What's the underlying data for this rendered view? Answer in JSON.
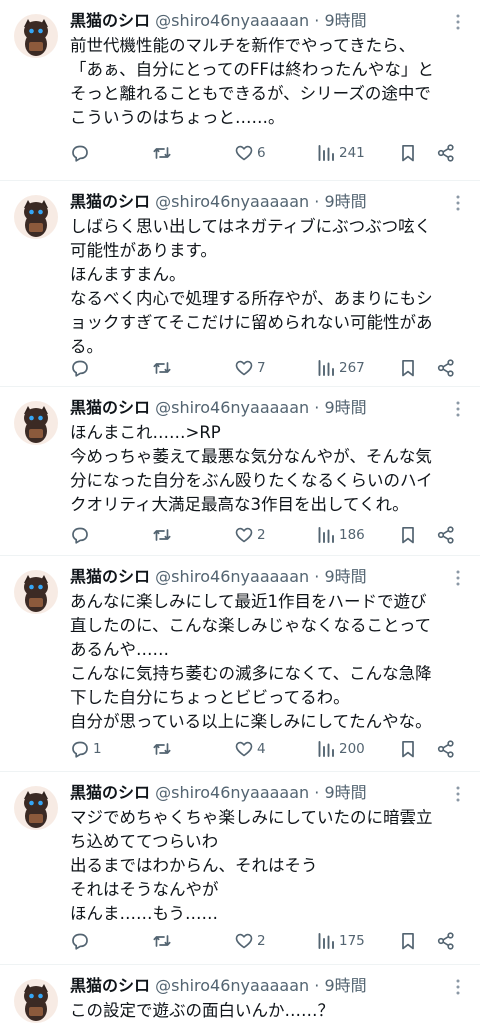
{
  "tweets": [
    {
      "author": "黒猫のシロ",
      "handle": "@shiro46nyaaaaan",
      "sep": "·",
      "time": "9時間",
      "text": "前世代機性能のマルチを新作でやってきたら、\n「あぁ、自分にとってのFFは終わったんやな」と\nそっと離れることもできるが、シリーズの途中で\nこういうのはちょっと……。",
      "replies": "",
      "retweets": "",
      "likes": "6",
      "views": "241"
    },
    {
      "author": "黒猫のシロ",
      "handle": "@shiro46nyaaaaan",
      "sep": "·",
      "time": "9時間",
      "text": "しばらく思い出してはネガティブにぶつぶつ呟く\n可能性があります。\nほんますまん。\nなるべく内心で処理する所存やが、あまりにもシ\nョックすぎてそこだけに留められない可能性があ\nる。",
      "replies": "",
      "retweets": "",
      "likes": "7",
      "views": "267"
    },
    {
      "author": "黒猫のシロ",
      "handle": "@shiro46nyaaaaan",
      "sep": "·",
      "time": "9時間",
      "text": "ほんまこれ……>RP\n今めっちゃ萎えて最悪な気分なんやが、そんな気\n分になった自分をぶん殴りたくなるくらいのハイ\nクオリティ大満足最高な3作目を出してくれ。",
      "replies": "",
      "retweets": "",
      "likes": "2",
      "views": "186"
    },
    {
      "author": "黒猫のシロ",
      "handle": "@shiro46nyaaaaan",
      "sep": "·",
      "time": "9時間",
      "text": "あんなに楽しみにして最近1作目をハードで遊び\n直したのに、こんな楽しみじゃなくなることって\nあるんや……\nこんなに気持ち萎むの滅多になくて、こんな急降\n下した自分にちょっとビビってるわ。\n自分が思っている以上に楽しみにしてたんやな。",
      "replies": "1",
      "retweets": "",
      "likes": "4",
      "views": "200"
    },
    {
      "author": "黒猫のシロ",
      "handle": "@shiro46nyaaaaan",
      "sep": "·",
      "time": "9時間",
      "text": "マジでめちゃくちゃ楽しみにしていたのに暗雲立\nち込めててつらいわ\n出るまではわからん、それはそう\nそれはそうなんやが\nほんま……もう……",
      "replies": "",
      "retweets": "",
      "likes": "2",
      "views": "175"
    },
    {
      "author": "黒猫のシロ",
      "handle": "@shiro46nyaaaaan",
      "sep": "·",
      "time": "9時間",
      "text": "この設定で遊ぶの面白いんか……？\nスクエニはどうしてしまったんだ",
      "replies": "",
      "retweets": "",
      "likes": "",
      "views": ""
    }
  ],
  "icons": {
    "reply": "reply-icon",
    "retweet": "retweet-icon",
    "like": "heart-icon",
    "views": "views-icon",
    "bookmark": "bookmark-icon",
    "share": "share-icon",
    "more": "more-icon"
  },
  "colors": {
    "text": "#0f1419",
    "secondary": "#536471",
    "divider": "#eff3f4"
  }
}
